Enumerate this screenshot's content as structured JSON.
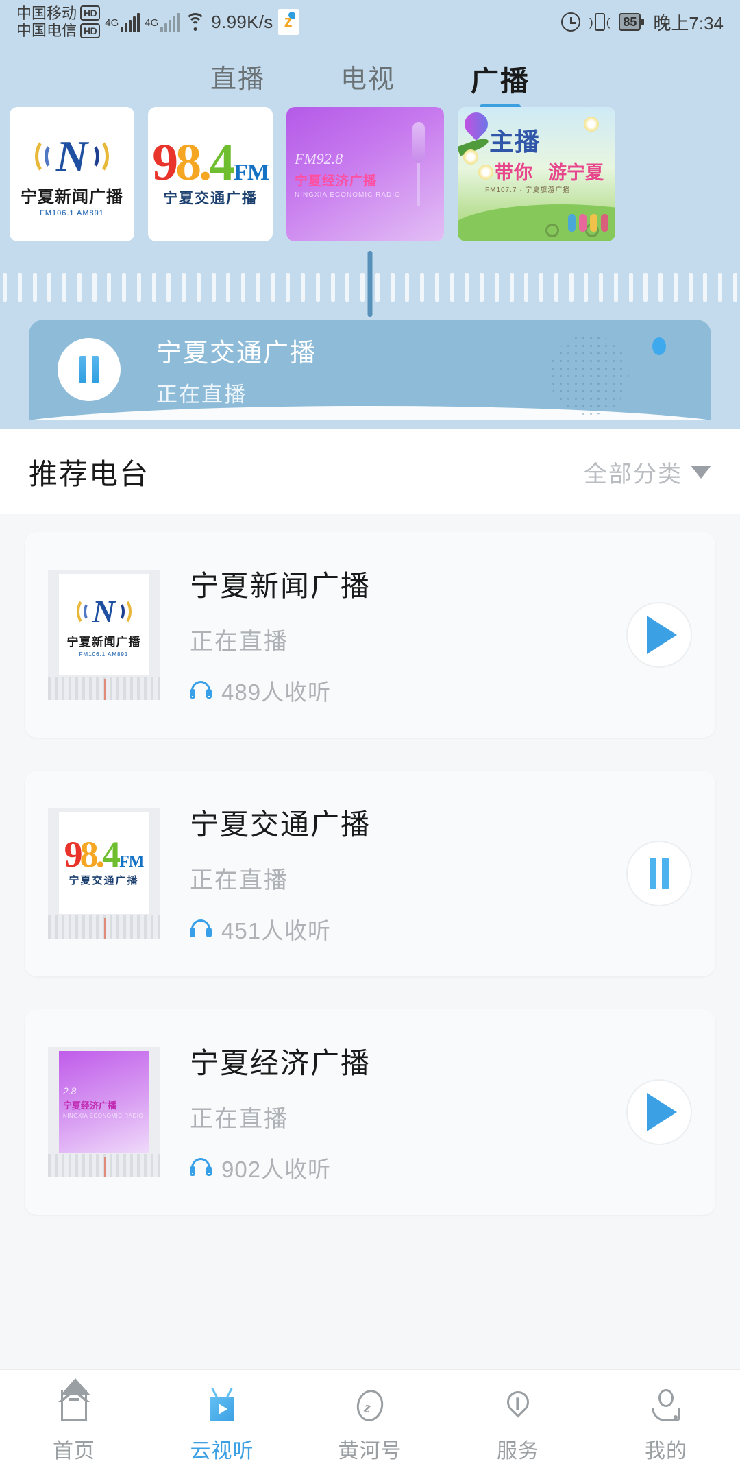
{
  "statusbar": {
    "carrier1": "中国移动",
    "carrier1_badge": "HD",
    "carrier2": "中国电信",
    "carrier2_badge": "HD",
    "net1": "4G",
    "net2": "4G",
    "speed": "9.99K/s",
    "app_icon": "ningxia-app-icon",
    "alarm_icon": "alarm-icon",
    "vibrate_icon": "vibrate-icon",
    "battery": "85",
    "time": "晚上7:34"
  },
  "tabs": [
    {
      "label": "直播",
      "active": false
    },
    {
      "label": "电视",
      "active": false
    },
    {
      "label": "广播",
      "active": true
    }
  ],
  "carousel": [
    {
      "name": "宁夏新闻广播",
      "logo_letter": "N",
      "logo_title": "宁夏新闻广播",
      "logo_sub": "FM106.1  AM891"
    },
    {
      "name": "宁夏交通广播",
      "freq_9": "9",
      "freq_8": "8",
      "freq_dot": ".",
      "freq_4": "4",
      "freq_fm": "FM",
      "logo_cn": "宁夏交通广播"
    },
    {
      "name": "宁夏经济广播",
      "fm_text": "FM92.8",
      "cn_text": "宁夏经济广播",
      "en_text": "NINGXIA ECONOMIC RADIO"
    },
    {
      "name": "主播带你游宁夏",
      "main_text": "主播",
      "sub_text": "带你",
      "sub_text2": "游宁夏",
      "line_text": "FM107.7 · 宁夏旅游广播"
    }
  ],
  "tuner": {
    "icon": "radio-dial"
  },
  "player": {
    "play_state": "playing",
    "pause_icon": "pause-icon",
    "title": "宁夏交通广播",
    "subtitle": "正在直播",
    "grille_icon": "speaker-grille",
    "led_icon": "led-indicator"
  },
  "section": {
    "title": "推荐电台",
    "filter_label": "全部分类",
    "caret_icon": "chevron-down-icon"
  },
  "stations": [
    {
      "name": "宁夏新闻广播",
      "status": "正在直播",
      "listeners": "489人收听",
      "headphone_icon": "headphone-icon",
      "state": "paused",
      "button_icon": "play-icon",
      "logo_type": "news",
      "logo_letter": "N",
      "logo_title": "宁夏新闻广播",
      "logo_sub": "FM106.1 AM891"
    },
    {
      "name": "宁夏交通广播",
      "status": "正在直播",
      "listeners": "451人收听",
      "headphone_icon": "headphone-icon",
      "state": "playing",
      "button_icon": "pause-icon",
      "logo_type": "traffic",
      "freq_9": "9",
      "freq_8": "8",
      "freq_dot": ".",
      "freq_4": "4",
      "freq_fm": "FM",
      "logo_cn": "宁夏交通广播"
    },
    {
      "name": "宁夏经济广播",
      "status": "正在直播",
      "listeners": "902人收听",
      "headphone_icon": "headphone-icon",
      "state": "paused",
      "button_icon": "play-icon",
      "logo_type": "economic",
      "fm_text": "2.8",
      "cn_text": "宁夏经济广播",
      "en_text": "NINGXIA ECONOMIC RADIO"
    }
  ],
  "bottomnav": [
    {
      "label": "首页",
      "icon": "home-icon",
      "active": false
    },
    {
      "label": "云视听",
      "icon": "tv-play-icon",
      "active": true
    },
    {
      "label": "黄河号",
      "icon": "huanghe-icon",
      "active": false
    },
    {
      "label": "服务",
      "icon": "service-heart-icon",
      "active": false
    },
    {
      "label": "我的",
      "icon": "user-icon",
      "active": false
    }
  ],
  "colors": {
    "accent": "#3ba0e4",
    "hero_bg": "#c3dbec",
    "player_bg": "#8ebcd8",
    "page_bg": "#f5f7f9"
  }
}
